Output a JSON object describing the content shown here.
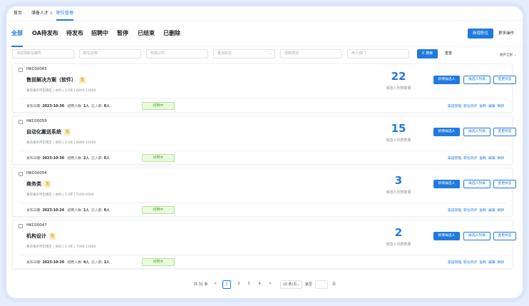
{
  "tabs": [
    {
      "label": "首页"
    },
    {
      "label": "储备人才"
    },
    {
      "label": "职位管理"
    }
  ],
  "tab_close": "x",
  "status_tabs": [
    "全部",
    "OA待发布",
    "待发布",
    "招聘中",
    "暂停",
    "已结束",
    "已删除"
  ],
  "header_actions": {
    "new_position": "新增职位",
    "more": "更多操作"
  },
  "filters": {
    "code_placeholder": "请选择职位编号",
    "name_placeholder": "职位名称",
    "company_placeholder": "所属公司",
    "key_placeholder": "重点职位",
    "category_placeholder": "招聘类别",
    "dept_placeholder": "用人部门",
    "search": "搜索",
    "reset": "重置",
    "expand": "展开全部"
  },
  "common": {
    "publish_label": "发布日期:",
    "hire_label": "招聘人数:",
    "joined_label": "已入职:",
    "count_label": "候选人列表数量",
    "btn_add": "新增候选人",
    "btn_list": "候选人列表",
    "btn_change": "变更状态",
    "links": [
      "渠道管理",
      "职位同步",
      "复制",
      "编辑",
      "刷新"
    ]
  },
  "jobs": [
    {
      "code": "HKC00065",
      "title": "售前解决方案（软件）",
      "badge": "急",
      "meta": "重庆重庆市巴南区 | 本科 | 3-5年 | 8000-13000",
      "date": "2023-10-30",
      "hire": "1人",
      "joined": "0人",
      "status": "招聘中",
      "count": "22"
    },
    {
      "code": "HKC00059",
      "title": "自动化搬送系统",
      "badge": "急",
      "meta": "重庆重庆市巴南区 | 本科 | 3-5年 | 8000-15000",
      "date": "2023-10-30",
      "hire": "2人",
      "joined": "0人",
      "status": "招聘中",
      "count": "15"
    },
    {
      "code": "HKC00054",
      "title": "商务类",
      "badge": "急",
      "meta": "重庆重庆市巴南区 | 本科 | 1-3年 | 5000-6000",
      "date": "2023-10-24",
      "hire": "1人",
      "joined": "0人",
      "status": "招聘中",
      "count": "3"
    },
    {
      "code": "HKC00047",
      "title": "机构设计",
      "badge": "急",
      "meta": "重庆重庆市巴南区 | 本科 | 1-3年 | 7000-13000",
      "date": "2023-10-20",
      "hire": "4人",
      "joined": "1人",
      "status": "招聘中",
      "count": "2"
    }
  ],
  "pagination": {
    "total": "共 32 条",
    "prev": "<",
    "next": ">",
    "pages": [
      "1",
      "2",
      "3",
      "4"
    ],
    "current": "1",
    "page_size": "10 条/页",
    "goto": "跳至",
    "page_suffix": "页"
  },
  "colors": {
    "accent": "#1f7ae0",
    "status_green": "#4fae1f",
    "badge_bg": "#fbe9b7"
  }
}
